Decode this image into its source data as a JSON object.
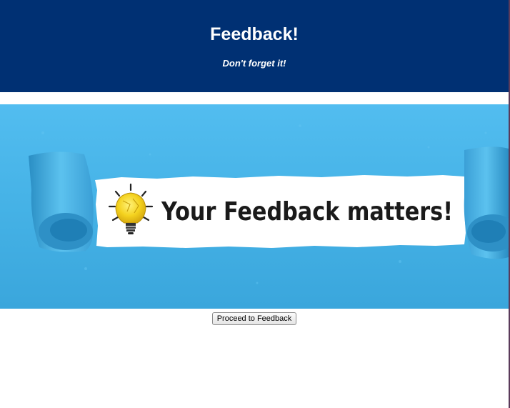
{
  "header": {
    "title": "Feedback!",
    "subtitle": "Don't forget it!"
  },
  "banner": {
    "text": "Your Feedback matters!",
    "icon": "lightbulb-icon"
  },
  "actions": {
    "proceed_label": "Proceed to Feedback"
  },
  "colors": {
    "header_bg": "#003073",
    "banner_blue": "#45b5e6"
  }
}
